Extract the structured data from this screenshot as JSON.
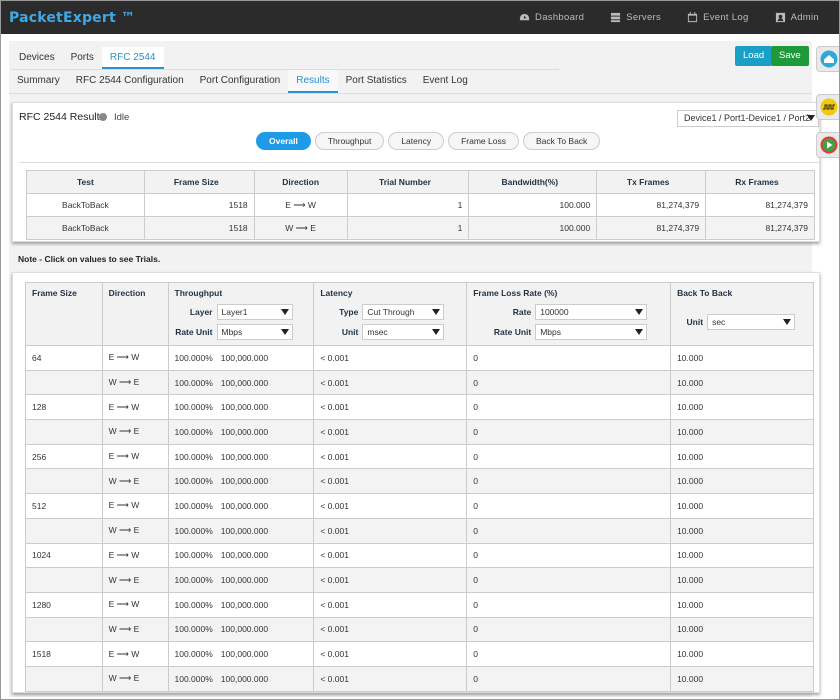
{
  "app": {
    "brand": "PacketExpert ™"
  },
  "nav": [
    {
      "label": "Dashboard",
      "icon": "dashboard-icon"
    },
    {
      "label": "Servers",
      "icon": "server-icon"
    },
    {
      "label": "Event Log",
      "icon": "calendar-icon"
    },
    {
      "label": "Admin",
      "icon": "user-icon"
    }
  ],
  "tabs1": [
    "Devices",
    "Ports",
    "RFC 2544"
  ],
  "tabs2": [
    "Summary",
    "RFC 2544 Configuration",
    "Port Configuration",
    "Results",
    "Port Statistics",
    "Event Log"
  ],
  "buttons": {
    "load": "Load",
    "save": "Save"
  },
  "results": {
    "title": "RFC 2544 Results",
    "status": "Idle",
    "device": "Device1 / Port1-Device1 / Port2"
  },
  "pills": [
    "Overall",
    "Throughput",
    "Latency",
    "Frame Loss",
    "Back To Back"
  ],
  "summary_table": {
    "headers": [
      "Test",
      "Frame Size",
      "Direction",
      "Trial Number",
      "Bandwidth(%)",
      "Tx Frames",
      "Rx Frames"
    ],
    "rows": [
      [
        "BackToBack",
        "1518",
        "E ⟶ W",
        "1",
        "100.000",
        "81,274,379",
        "81,274,379"
      ],
      [
        "BackToBack",
        "1518",
        "W ⟶ E",
        "1",
        "100.000",
        "81,274,379",
        "81,274,379"
      ]
    ]
  },
  "note": "Note - Click on values to see Trials.",
  "detail": {
    "headers": {
      "frame_size": "Frame Size",
      "direction": "Direction",
      "throughput": "Throughput",
      "latency": "Latency",
      "frame_loss": "Frame Loss Rate (%)",
      "back_to_back": "Back To Back"
    },
    "controls": {
      "layer_label": "Layer",
      "layer_value": "Layer1",
      "rate_unit_label": "Rate Unit",
      "rate_unit_value": "Mbps",
      "type_label": "Type",
      "type_value": "Cut Through",
      "unit_label": "Unit",
      "unit_value": "msec",
      "rate_label": "Rate",
      "rate_value": "100000",
      "fl_rate_unit_label": "Rate Unit",
      "fl_rate_unit_value": "Mbps",
      "b2b_unit_label": "Unit",
      "b2b_unit_value": "sec"
    },
    "rows": [
      [
        "64",
        "E ⟶ W",
        "100.000%",
        "100,000.000",
        "< 0.001",
        "0",
        "10.000"
      ],
      [
        "",
        "W ⟶ E",
        "100.000%",
        "100,000.000",
        "< 0.001",
        "0",
        "10.000"
      ],
      [
        "128",
        "E ⟶ W",
        "100.000%",
        "100,000.000",
        "< 0.001",
        "0",
        "10.000"
      ],
      [
        "",
        "W ⟶ E",
        "100.000%",
        "100,000.000",
        "< 0.001",
        "0",
        "10.000"
      ],
      [
        "256",
        "E ⟶ W",
        "100.000%",
        "100,000.000",
        "< 0.001",
        "0",
        "10.000"
      ],
      [
        "",
        "W ⟶ E",
        "100.000%",
        "100,000.000",
        "< 0.001",
        "0",
        "10.000"
      ],
      [
        "512",
        "E ⟶ W",
        "100.000%",
        "100,000.000",
        "< 0.001",
        "0",
        "10.000"
      ],
      [
        "",
        "W ⟶ E",
        "100.000%",
        "100,000.000",
        "< 0.001",
        "0",
        "10.000"
      ],
      [
        "1024",
        "E ⟶ W",
        "100.000%",
        "100,000.000",
        "< 0.001",
        "0",
        "10.000"
      ],
      [
        "",
        "W ⟶ E",
        "100.000%",
        "100,000.000",
        "< 0.001",
        "0",
        "10.000"
      ],
      [
        "1280",
        "E ⟶ W",
        "100.000%",
        "100,000.000",
        "< 0.001",
        "0",
        "10.000"
      ],
      [
        "",
        "W ⟶ E",
        "100.000%",
        "100,000.000",
        "< 0.001",
        "0",
        "10.000"
      ],
      [
        "1518",
        "E ⟶ W",
        "100.000%",
        "100,000.000",
        "< 0.001",
        "0",
        "10.000"
      ],
      [
        "",
        "W ⟶ E",
        "100.000%",
        "100,000.000",
        "< 0.001",
        "0",
        "10.000"
      ]
    ]
  },
  "colors": {
    "accent": "#2b8fd0",
    "load": "#1aa0c6",
    "save": "#1e9a3a",
    "nav_bg": "#2b2b2b"
  }
}
